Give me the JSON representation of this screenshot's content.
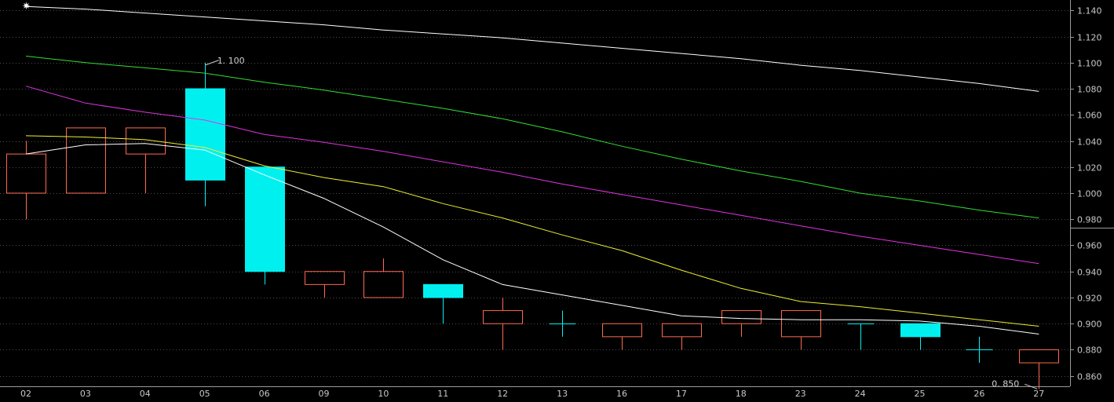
{
  "chart_data": {
    "type": "candlestick",
    "categories": [
      "02",
      "03",
      "04",
      "05",
      "06",
      "09",
      "10",
      "11",
      "12",
      "13",
      "16",
      "17",
      "18",
      "23",
      "24",
      "25",
      "26",
      "27"
    ],
    "candles": [
      {
        "open": 1.0,
        "high": 1.04,
        "low": 0.98,
        "close": 1.03
      },
      {
        "open": 1.0,
        "high": 1.05,
        "low": 1.0,
        "close": 1.05
      },
      {
        "open": 1.03,
        "high": 1.05,
        "low": 1.0,
        "close": 1.05
      },
      {
        "open": 1.08,
        "high": 1.1,
        "low": 0.99,
        "close": 1.01
      },
      {
        "open": 1.02,
        "high": 1.02,
        "low": 0.93,
        "close": 0.94
      },
      {
        "open": 0.93,
        "high": 0.94,
        "low": 0.92,
        "close": 0.94
      },
      {
        "open": 0.92,
        "high": 0.95,
        "low": 0.92,
        "close": 0.94
      },
      {
        "open": 0.93,
        "high": 0.93,
        "low": 0.9,
        "close": 0.92
      },
      {
        "open": 0.9,
        "high": 0.92,
        "low": 0.88,
        "close": 0.91
      },
      {
        "open": 0.9,
        "high": 0.91,
        "low": 0.89,
        "close": 0.9
      },
      {
        "open": 0.89,
        "high": 0.9,
        "low": 0.88,
        "close": 0.9
      },
      {
        "open": 0.89,
        "high": 0.9,
        "low": 0.88,
        "close": 0.9
      },
      {
        "open": 0.9,
        "high": 0.91,
        "low": 0.89,
        "close": 0.91
      },
      {
        "open": 0.89,
        "high": 0.91,
        "low": 0.88,
        "close": 0.91
      },
      {
        "open": 0.9,
        "high": 0.9,
        "low": 0.88,
        "close": 0.9
      },
      {
        "open": 0.9,
        "high": 0.9,
        "low": 0.88,
        "close": 0.89
      },
      {
        "open": 0.88,
        "high": 0.89,
        "low": 0.87,
        "close": 0.88
      },
      {
        "open": 0.87,
        "high": 0.88,
        "low": 0.85,
        "close": 0.88
      }
    ],
    "series": [
      {
        "color": "#ffffff",
        "values": [
          1.143,
          1.141,
          1.138,
          1.135,
          1.132,
          1.129,
          1.125,
          1.122,
          1.119,
          1.115,
          1.111,
          1.107,
          1.103,
          1.098,
          1.094,
          1.089,
          1.084,
          1.078
        ]
      },
      {
        "color": "#33dd33",
        "values": [
          1.105,
          1.1,
          1.096,
          1.092,
          1.085,
          1.079,
          1.072,
          1.065,
          1.057,
          1.047,
          1.036,
          1.026,
          1.017,
          1.009,
          1.0,
          0.994,
          0.987,
          0.981
        ]
      },
      {
        "color": "#e033e0",
        "values": [
          1.082,
          1.069,
          1.062,
          1.056,
          1.045,
          1.039,
          1.032,
          1.024,
          1.016,
          1.007,
          0.999,
          0.991,
          0.983,
          0.975,
          0.967,
          0.96,
          0.953,
          0.946
        ]
      },
      {
        "color": "#eeee33",
        "values": [
          1.044,
          1.043,
          1.041,
          1.035,
          1.021,
          1.012,
          1.005,
          0.992,
          0.981,
          0.968,
          0.956,
          0.941,
          0.927,
          0.917,
          0.913,
          0.908,
          0.903,
          0.898
        ]
      },
      {
        "color": "#ffffff",
        "values": [
          1.03,
          1.037,
          1.038,
          1.033,
          1.014,
          0.996,
          0.974,
          0.949,
          0.93,
          0.922,
          0.914,
          0.906,
          0.904,
          0.903,
          0.903,
          0.902,
          0.898,
          0.892
        ]
      }
    ],
    "yticks": [
      "1.140",
      "1.120",
      "1.100",
      "1.080",
      "1.060",
      "1.040",
      "1.020",
      "1.000",
      "0.980",
      "0.960",
      "0.940",
      "0.920",
      "0.900",
      "0.880",
      "0.860"
    ],
    "ylim": [
      0.852,
      1.148
    ],
    "annotations": [
      {
        "text": "1. 100",
        "x": "05",
        "y": 1.1
      },
      {
        "text": "0. 850",
        "x": "27",
        "y": 0.85
      }
    ],
    "title": "",
    "xlabel": "",
    "ylabel": "",
    "grid": true,
    "colors": {
      "up": "#ff6a4d",
      "down": "#00f0f0",
      "grid": "#4a4a4a",
      "axis": "#9a9a9a"
    }
  },
  "marker": "✷"
}
